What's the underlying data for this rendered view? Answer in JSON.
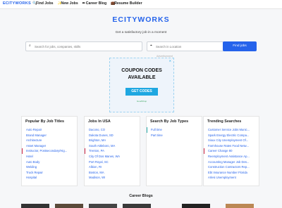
{
  "header": {
    "logo": "ECITYWORKS",
    "nav": [
      {
        "icon": "search-icon",
        "label": "Find Jobs"
      },
      {
        "icon": "sparkle-icon",
        "label": "New Jobs"
      },
      {
        "icon": "pencil-icon",
        "label": "Career Blog"
      },
      {
        "icon": "briefcase-icon",
        "label": "Resume Builder"
      }
    ]
  },
  "hero": {
    "brand": "ECITYWORKS",
    "tagline": "Get a satisfactory job in a moment"
  },
  "search": {
    "keyword_placeholder": "Search for jobs, companies, skills",
    "location_placeholder": "Search in Location",
    "button": "Find jobs"
  },
  "ad": {
    "label": "Advertisement",
    "line1": "COUPON CODES",
    "line2": "AVAILABLE",
    "cta": "GET CODES",
    "fine": "GoodShop"
  },
  "cards": {
    "titles": {
      "title": "Popular By Job Titles",
      "usa": "Jobs In USA",
      "types": "Search By Job Types",
      "trending": "Trending Searches"
    },
    "job_titles": [
      "Auto Repair",
      "Brand Manager",
      "Architecture",
      "Asset Manager",
      "Instructor, Postsecondary/Hig...",
      "Hotel",
      "Auto Body",
      "Welding",
      "Truck Repair",
      "Hospital"
    ],
    "usa": [
      "Dacono, CO",
      "Dakota Dunes, SD",
      "Brighton, MA",
      "South Attleboro, MA",
      "Trenton, PA",
      "City Of Dos Manes, WA",
      "Port Royal, SC",
      "Albion, RI",
      "Boston, MA",
      "Madison, WI"
    ],
    "types": [
      "Full time",
      "Part time"
    ],
    "trending": [
      "Customer Service Jobs Munic...",
      "Spark Energy Electric Compa...",
      "Sioux City Unemployment Of...",
      "Farmhouse Rates Food Netw...",
      "Career Change 80",
      "Reemployment Assistance Ap...",
      "Accounting Manager Job Des...",
      "Construction Contractors Rep...",
      "Ebt Insurance Number Florida",
      "Arlesi Unemployment"
    ]
  },
  "blogs": {
    "title": "Career Blogs"
  }
}
